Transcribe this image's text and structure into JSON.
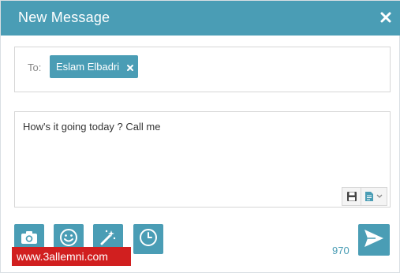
{
  "header": {
    "title": "New Message",
    "close_icon": "close-icon"
  },
  "recipients": {
    "label": "To:",
    "chips": [
      {
        "name": "Eslam Elbadri",
        "remove_icon": "remove-icon"
      }
    ]
  },
  "message": {
    "text": "How's it going today ? Call me",
    "tools": [
      "save-draft-icon",
      "template-icon"
    ]
  },
  "actions": {
    "buttons": [
      "camera-icon",
      "emoji-icon",
      "magic-wand-icon",
      "clock-icon"
    ],
    "char_count": "970",
    "send_icon": "send-icon"
  },
  "watermark": {
    "text": "www.3allemni.com"
  },
  "colors": {
    "accent": "#4a9db5",
    "watermark_bg": "#d11f1f",
    "border": "#d6d6d6"
  }
}
